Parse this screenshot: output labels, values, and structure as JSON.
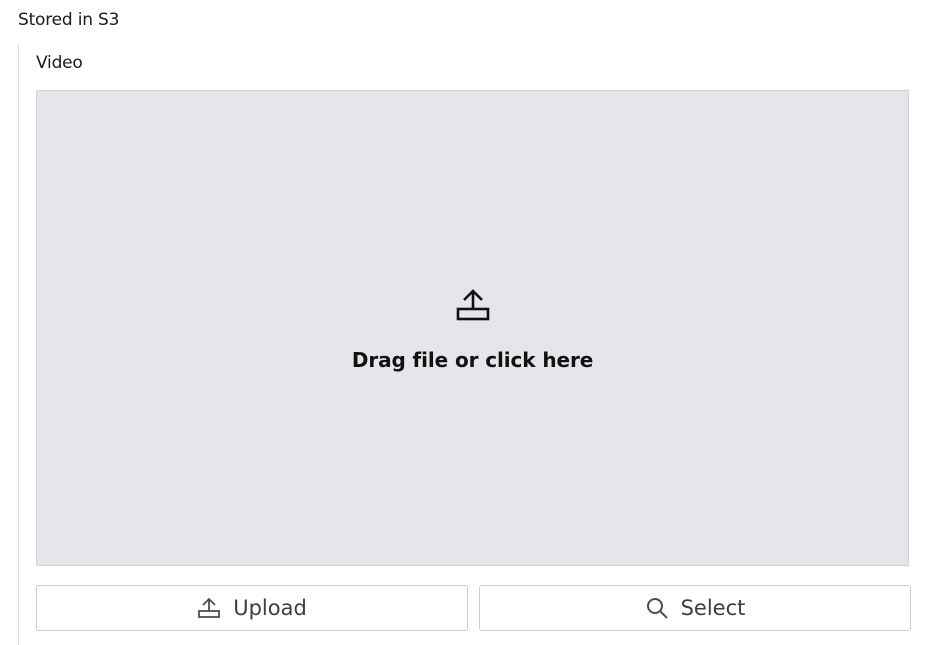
{
  "section": {
    "title": "Stored in S3"
  },
  "field": {
    "label": "Video"
  },
  "dropzone": {
    "icon": "upload-icon",
    "text": "Drag file or click here"
  },
  "actions": {
    "upload": {
      "label": "Upload",
      "icon": "upload-icon"
    },
    "select": {
      "label": "Select",
      "icon": "search-icon"
    }
  }
}
